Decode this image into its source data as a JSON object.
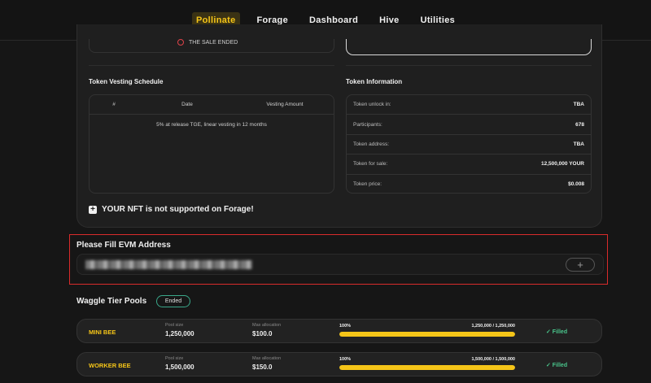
{
  "nav": {
    "items": [
      {
        "label": "Pollinate",
        "active": true
      },
      {
        "label": "Forage",
        "active": false
      },
      {
        "label": "Dashboard",
        "active": false
      },
      {
        "label": "Hive",
        "active": false
      },
      {
        "label": "Utilities",
        "active": false
      }
    ]
  },
  "sale_status": "THE SALE ENDED",
  "vesting": {
    "title": "Token Vesting Schedule",
    "columns": [
      "#",
      "Date",
      "Vesting Amount"
    ],
    "note": "5% at release TGE, linear vesting in 12 months"
  },
  "token_info": {
    "title": "Token Information",
    "rows": [
      {
        "label": "Token unlock in:",
        "value": "TBA"
      },
      {
        "label": "Participants:",
        "value": "678"
      },
      {
        "label": "Token address:",
        "value": "TBA"
      },
      {
        "label": "Token for sale:",
        "value": "12,500,000 YOUR"
      },
      {
        "label": "Token price:",
        "value": "$0.008"
      }
    ]
  },
  "nft_note": "YOUR NFT is not supported on Forage!",
  "evm": {
    "title": "Please Fill EVM Address",
    "value": "0x4f3b9e2a7c61d8b05e9a4c3f17d2b6e8a90c5f1d",
    "add_label": "+"
  },
  "pools": {
    "title": "Waggle Tier Pools",
    "badge": "Ended",
    "pool_size_label": "Pool size",
    "max_alloc_label": "Max allocation",
    "items": [
      {
        "name": "MINI BEE",
        "pool_size": "1,250,000",
        "max_allocation": "$100.0",
        "percent_label": "100%",
        "progress": 1.0,
        "amount": "1,250,000 / 1,250,000",
        "status": "✓ Filled"
      },
      {
        "name": "WORKER BEE",
        "pool_size": "1,500,000",
        "max_allocation": "$150.0",
        "percent_label": "100%",
        "progress": 1.0,
        "amount": "1,500,000 / 1,500,000",
        "status": "✓ Filled"
      }
    ]
  },
  "colors": {
    "accent": "#f5c518",
    "highlight_border": "#d92b2b",
    "success": "#49c48b"
  }
}
